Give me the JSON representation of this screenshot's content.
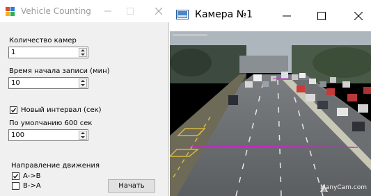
{
  "left_window": {
    "title": "Vehicle Counting",
    "camera_count": {
      "label": "Количество камер",
      "value": "1"
    },
    "start_time": {
      "label": "Время начала записи (мин)",
      "value": "10"
    },
    "new_interval": {
      "label": "Новый интервал (сек)",
      "checked": true
    },
    "default_interval": {
      "label": "По умолчанию 600 сек",
      "value": "100"
    },
    "direction": {
      "label": "Направление движения",
      "options": [
        {
          "label": "A->B",
          "checked": true
        },
        {
          "label": "B->A",
          "checked": false
        }
      ]
    },
    "start_button": "Начать"
  },
  "right_window": {
    "title": "Камера №1",
    "watermark": "ManyCam.com",
    "counting_line_color": "#d020d0"
  }
}
